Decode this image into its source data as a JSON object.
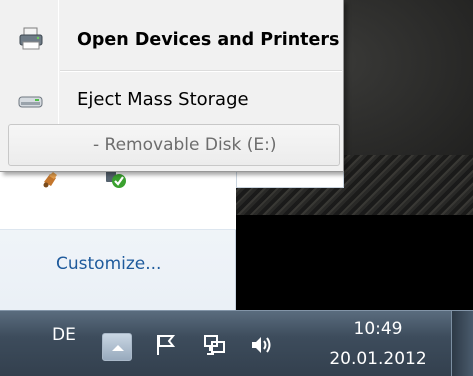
{
  "context_menu": {
    "items": [
      {
        "label": "Open Devices and Printers",
        "icon": "printer-icon",
        "default": true
      },
      {
        "label": "Eject Mass Storage",
        "icon": "drive-icon",
        "default": false
      },
      {
        "label": "-  Removable Disk (E:)",
        "icon": null,
        "default": false,
        "disabled": true
      }
    ]
  },
  "tray_flyout": {
    "customize_label": "Customize...",
    "icons": [
      "usb-device-icon",
      "network-check-icon"
    ]
  },
  "taskbar": {
    "language": "DE",
    "icons": [
      "show-hidden-icons-button",
      "action-center-flag-icon",
      "network-icon",
      "volume-icon"
    ],
    "clock": {
      "time": "10:49",
      "date": "20.01.2012"
    }
  },
  "colors": {
    "menu_bg": "#f1f1f1",
    "link": "#1e5a9c",
    "taskbar": "#3d4c5c",
    "disabled_text": "#6d6d6d"
  }
}
